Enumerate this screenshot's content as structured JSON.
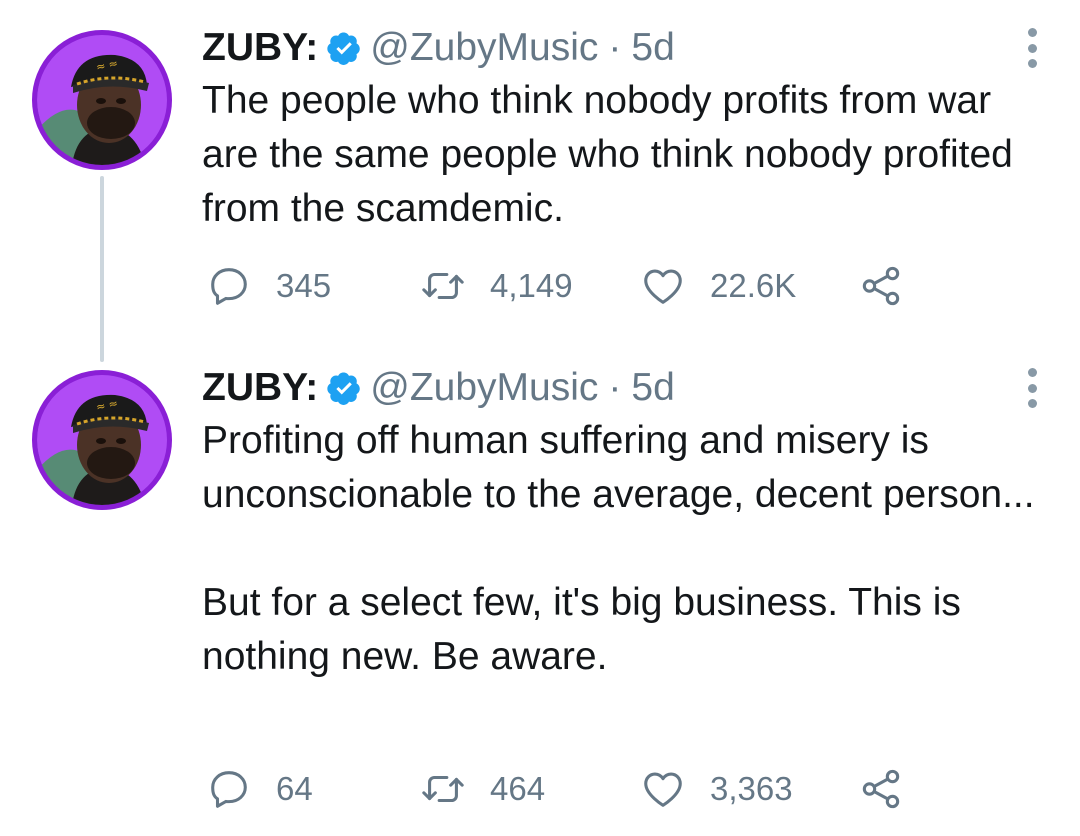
{
  "tweets": [
    {
      "author": {
        "display_name": "ZUBY:",
        "handle": "@ZubyMusic",
        "verified": true
      },
      "separator": "·",
      "time": "5d",
      "text": "The people who think nobody profits from war are the same people who think nobody profited from the scamdemic.",
      "stats": {
        "replies": "345",
        "retweets": "4,149",
        "likes": "22.6K"
      }
    },
    {
      "author": {
        "display_name": "ZUBY:",
        "handle": "@ZubyMusic",
        "verified": true
      },
      "separator": "·",
      "time": "5d",
      "text": "Profiting off human suffering and misery is unconscionable to the average, decent person...\n\nBut for a select few, it's big business. This is nothing new. Be aware.",
      "stats": {
        "replies": "64",
        "retweets": "464",
        "likes": "3,363"
      }
    }
  ],
  "icons": {
    "reply": "reply-icon",
    "retweet": "retweet-icon",
    "like": "heart-icon",
    "share": "share-icon",
    "more": "more-vertical-icon",
    "verified": "verified-badge-icon"
  },
  "colors": {
    "verified_blue": "#1da1f2",
    "secondary_text": "#657786",
    "primary_text": "#14171a",
    "avatar_ring": "#8a1fd6"
  }
}
